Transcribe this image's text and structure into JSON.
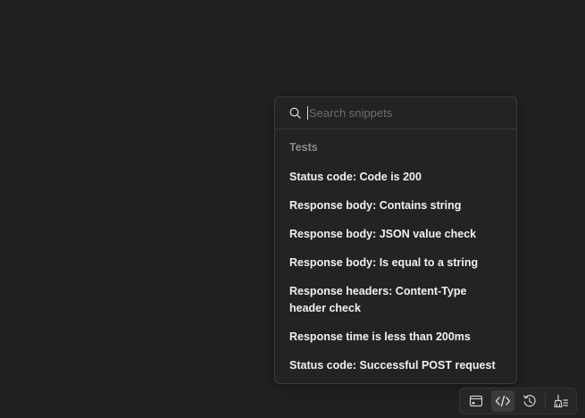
{
  "snippets": {
    "search_placeholder": "Search snippets",
    "section_label": "Tests",
    "items": [
      {
        "label": "Status code: Code is 200"
      },
      {
        "label": "Response body: Contains string"
      },
      {
        "label": "Response body: JSON value check"
      },
      {
        "label": "Response body: Is equal to a string"
      },
      {
        "label": "Response headers: Content-Type header check"
      },
      {
        "label": "Response time is less than 200ms"
      },
      {
        "label": "Status code: Successful POST request"
      }
    ]
  },
  "toolbar": {
    "buttons": [
      {
        "icon": "window-icon",
        "active": false
      },
      {
        "icon": "code-icon",
        "active": true
      },
      {
        "icon": "clock-refresh-icon",
        "active": false
      },
      {
        "icon": "broom-icon",
        "active": false
      }
    ]
  },
  "colors": {
    "background": "#212121",
    "popover": "#232323",
    "text": "#f0f0f0",
    "muted": "#8a8a8a"
  }
}
